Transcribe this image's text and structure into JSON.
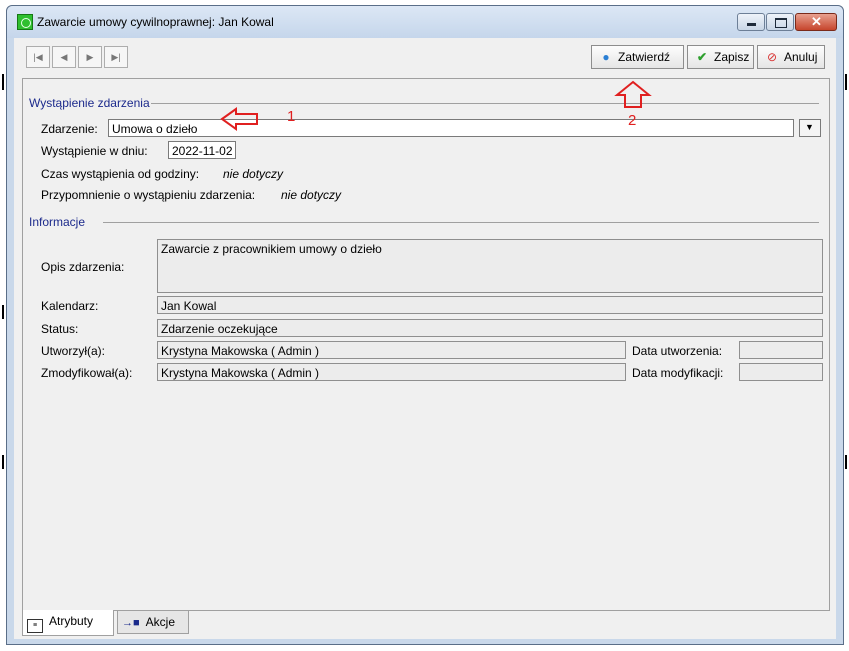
{
  "window": {
    "title": "Zawarcie umowy cywilnoprawnej: Jan Kowal"
  },
  "caption_buttons": {
    "minimize": "minimize-icon",
    "maximize": "maximize-icon",
    "close": "close-icon"
  },
  "nav": {
    "icons": [
      "first-record-icon",
      "previous-record-icon",
      "next-record-icon",
      "last-record-icon"
    ]
  },
  "toolbar": {
    "confirm_label": "Zatwierdź",
    "save_label": "Zapisz",
    "cancel_label": "Anuluj"
  },
  "occurrence": {
    "header": "Wystąpienie zdarzenia",
    "event_label": "Zdarzenie:",
    "event_value": "Umowa o dzieło",
    "date_label": "Wystąpienie w dniu:",
    "date_value": "2022-11-02",
    "time_label": "Czas wystąpienia od godziny:",
    "time_value": "nie dotyczy",
    "reminder_label": "Przypomnienie o wystąpieniu zdarzenia:",
    "reminder_value": "nie dotyczy"
  },
  "info": {
    "header": "Informacje",
    "description_label": "Opis zdarzenia:",
    "description_value": "Zawarcie z pracownikiem umowy o dzieło",
    "calendar_label": "Kalendarz:",
    "calendar_value": "Jan Kowal",
    "status_label": "Status:",
    "status_value": "Zdarzenie oczekujące",
    "created_by_label": "Utworzył(a):",
    "created_by_value": "Krystyna Makowska ( Admin )",
    "modified_by_label": "Zmodyfikował(a):",
    "modified_by_value": "Krystyna Makowska ( Admin )",
    "created_date_label": "Data utworzenia:",
    "created_date_value": "",
    "modified_date_label": "Data modyfikacji:",
    "modified_date_value": ""
  },
  "annotations": {
    "arrow1_number": "1",
    "arrow2_number": "2"
  },
  "tabs": [
    {
      "label": "Atrybuty",
      "active": true
    },
    {
      "label": "Akcje",
      "active": false
    }
  ],
  "colors": {
    "section_header": "#1c2a8c",
    "annotation": "#e02020",
    "confirm_dot": "#2a7fd4",
    "save_check": "#2ea02e",
    "cancel_icon": "#d83030"
  }
}
